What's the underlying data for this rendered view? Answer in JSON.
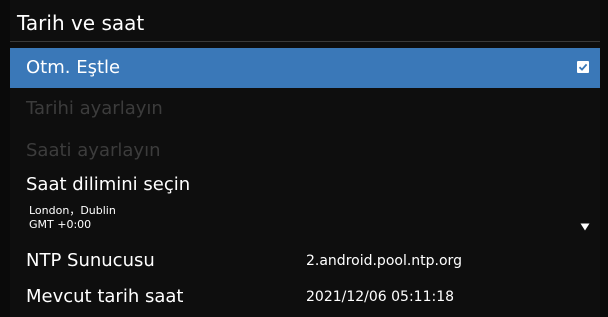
{
  "title": "Tarih ve saat",
  "auto_sync": {
    "label": "Otm. Eştle",
    "checked": true,
    "icon": "checkbox-checked-icon"
  },
  "set_date": {
    "label": "Tarihi ayarlayın",
    "enabled": false
  },
  "set_time": {
    "label": "Saati ayarlayın",
    "enabled": false
  },
  "time_zone": {
    "label": "Saat dilimini seçin",
    "city": "London，Dublin",
    "offset": "GMT +0:00",
    "icon": "dropdown-arrow-icon"
  },
  "ntp_server": {
    "label": "NTP Sunucusu",
    "value": "2.android.pool.ntp.org"
  },
  "current_datetime": {
    "label": "Mevcut tarih saat",
    "value": "2021/12/06 05:11:18"
  },
  "colors": {
    "background": "#0e0e0e",
    "selected_row": "#3a78b8",
    "disabled_text": "#3c3c3c",
    "text": "#ffffff"
  }
}
